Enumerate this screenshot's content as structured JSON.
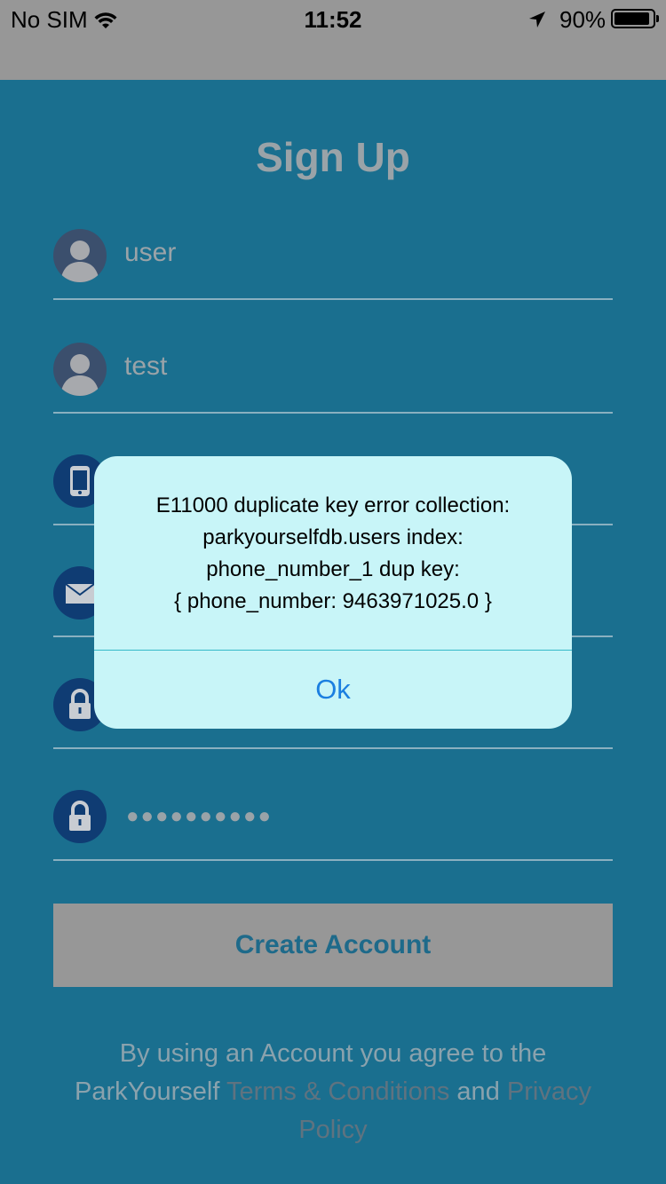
{
  "status_bar": {
    "carrier": "No SIM",
    "time": "11:52",
    "battery": "90%"
  },
  "form": {
    "title": "Sign Up",
    "fields": [
      {
        "value": "user",
        "icon": "person-icon"
      },
      {
        "value": "test",
        "icon": "person-icon"
      },
      {
        "value": "",
        "icon": "phone-icon"
      },
      {
        "value": "",
        "icon": "envelope-icon"
      },
      {
        "value": "",
        "icon": "lock-icon"
      },
      {
        "value": "●●●●●●●●●●",
        "icon": "lock-icon"
      }
    ],
    "create_button": "Create Account",
    "terms": {
      "prefix": "By using an Account you agree to the ParkYourself ",
      "terms_link": "Terms & Conditions",
      "middle": " and ",
      "privacy_link": "Privacy Policy"
    }
  },
  "alert": {
    "message_lines": [
      "E11000 duplicate key error collection:",
      "parkyourselfdb.users index:",
      "phone_number_1 dup key:",
      "{ phone_number: 9463971025.0 }"
    ],
    "ok_label": "Ok"
  },
  "colors": {
    "background": "#1a6f8f",
    "alert_background": "#c8f5f8",
    "ok_text": "#1b7fe0"
  }
}
